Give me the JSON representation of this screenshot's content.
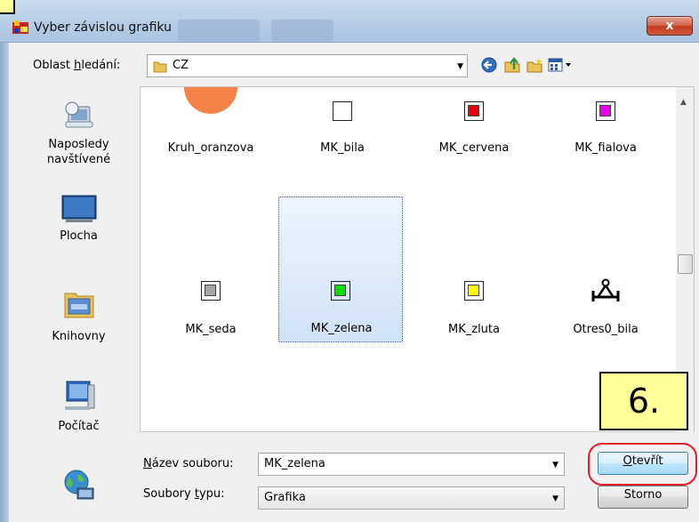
{
  "dialog": {
    "title": "Vyber závislou grafiku",
    "close_label": "x"
  },
  "toolbar": {
    "lookin_label_pre": "Oblast ",
    "lookin_label_key": "h",
    "lookin_label_post": "ledání:",
    "lookin_value": "CZ",
    "icons": [
      "back-icon",
      "up-folder-icon",
      "new-folder-icon",
      "view-menu-icon"
    ]
  },
  "places": [
    {
      "label_1": "Naposledy",
      "label_2": "navštívené",
      "icon": "recent-places-icon"
    },
    {
      "label_1": "Plocha",
      "label_2": "",
      "icon": "desktop-icon"
    },
    {
      "label_1": "Knihovny",
      "label_2": "",
      "icon": "libraries-icon"
    },
    {
      "label_1": "Počítač",
      "label_2": "",
      "icon": "computer-icon"
    },
    {
      "label_1": "",
      "label_2": "",
      "icon": "network-icon"
    }
  ],
  "files": [
    {
      "name": "Kruh_oranzova",
      "color": "#f58247",
      "kind": "circle"
    },
    {
      "name": "MK_bila",
      "color": "#ffffff",
      "kind": "swatch"
    },
    {
      "name": "MK_cervena",
      "color": "#e8000b",
      "kind": "swatch"
    },
    {
      "name": "MK_fialova",
      "color": "#e800e8",
      "kind": "swatch"
    },
    {
      "name": "MK_seda",
      "color": "#a6a6a6",
      "kind": "swatch"
    },
    {
      "name": "MK_zelena",
      "color": "#00e000",
      "kind": "swatch",
      "selected": true
    },
    {
      "name": "MK_zluta",
      "color": "#ffff00",
      "kind": "swatch"
    },
    {
      "name": "Otres0_bila",
      "color": "#000000",
      "kind": "symbol"
    }
  ],
  "form": {
    "filename_label_key": "N",
    "filename_label_rest": "ázev souboru:",
    "filename_value": "MK_zelena",
    "filetype_label_pre": "Soubory ",
    "filetype_label_key": "t",
    "filetype_label_post": "ypu:",
    "filetype_value": "Grafika",
    "open_key": "O",
    "open_rest": "tevřít",
    "cancel_label": "Storno"
  },
  "annotation": {
    "step": "6."
  },
  "colors": {
    "highlight_ring": "#e31d2a",
    "note_bg": "#ffff99",
    "selection": "#cfe3f8"
  }
}
